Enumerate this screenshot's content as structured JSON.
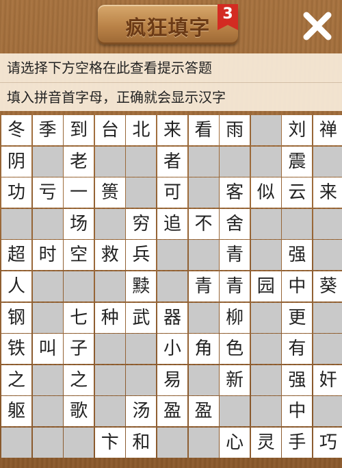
{
  "header": {
    "title": "疯狂填字",
    "level": "3"
  },
  "hints": {
    "line1": "请选择下方空格在此查看提示答题",
    "line2": "填入拼音首字母，正确就会显示汉字"
  },
  "grid": [
    [
      "冬",
      "季",
      "到",
      "台",
      "北",
      "来",
      "看",
      "雨",
      "",
      "刘",
      "禅"
    ],
    [
      "阴",
      "",
      "老",
      "",
      "",
      "者",
      "",
      "",
      "",
      "震",
      ""
    ],
    [
      "功",
      "亏",
      "一",
      "篑",
      "",
      "可",
      "",
      "客",
      "似",
      "云",
      "来"
    ],
    [
      "",
      "",
      "场",
      "",
      "穷",
      "追",
      "不",
      "舍",
      "",
      "",
      ""
    ],
    [
      "超",
      "时",
      "空",
      "救",
      "兵",
      "",
      "",
      "青",
      "",
      "强",
      ""
    ],
    [
      "人",
      "",
      "",
      "",
      "黩",
      "",
      "青",
      "青",
      "园",
      "中",
      "葵"
    ],
    [
      "钢",
      "",
      "七",
      "种",
      "武",
      "器",
      "",
      "柳",
      "",
      "更",
      ""
    ],
    [
      "铁",
      "叫",
      "子",
      "",
      "",
      "小",
      "角",
      "色",
      "",
      "有",
      ""
    ],
    [
      "之",
      "",
      "之",
      "",
      "",
      "易",
      "",
      "新",
      "",
      "强",
      "奸"
    ],
    [
      "躯",
      "",
      "歌",
      "",
      "汤",
      "盈",
      "盈",
      "",
      "",
      "中",
      ""
    ],
    [
      "",
      "",
      "",
      "卞",
      "和",
      "",
      "",
      "心",
      "灵",
      "手",
      "巧"
    ]
  ],
  "colors": {
    "empty_cell": "#c9c9c9",
    "filled_cell": "#ffffff",
    "badge": "#d32b22",
    "title_text": "#6b3a16"
  },
  "icons": {
    "close": "close-icon",
    "badge": "ribbon-badge"
  }
}
